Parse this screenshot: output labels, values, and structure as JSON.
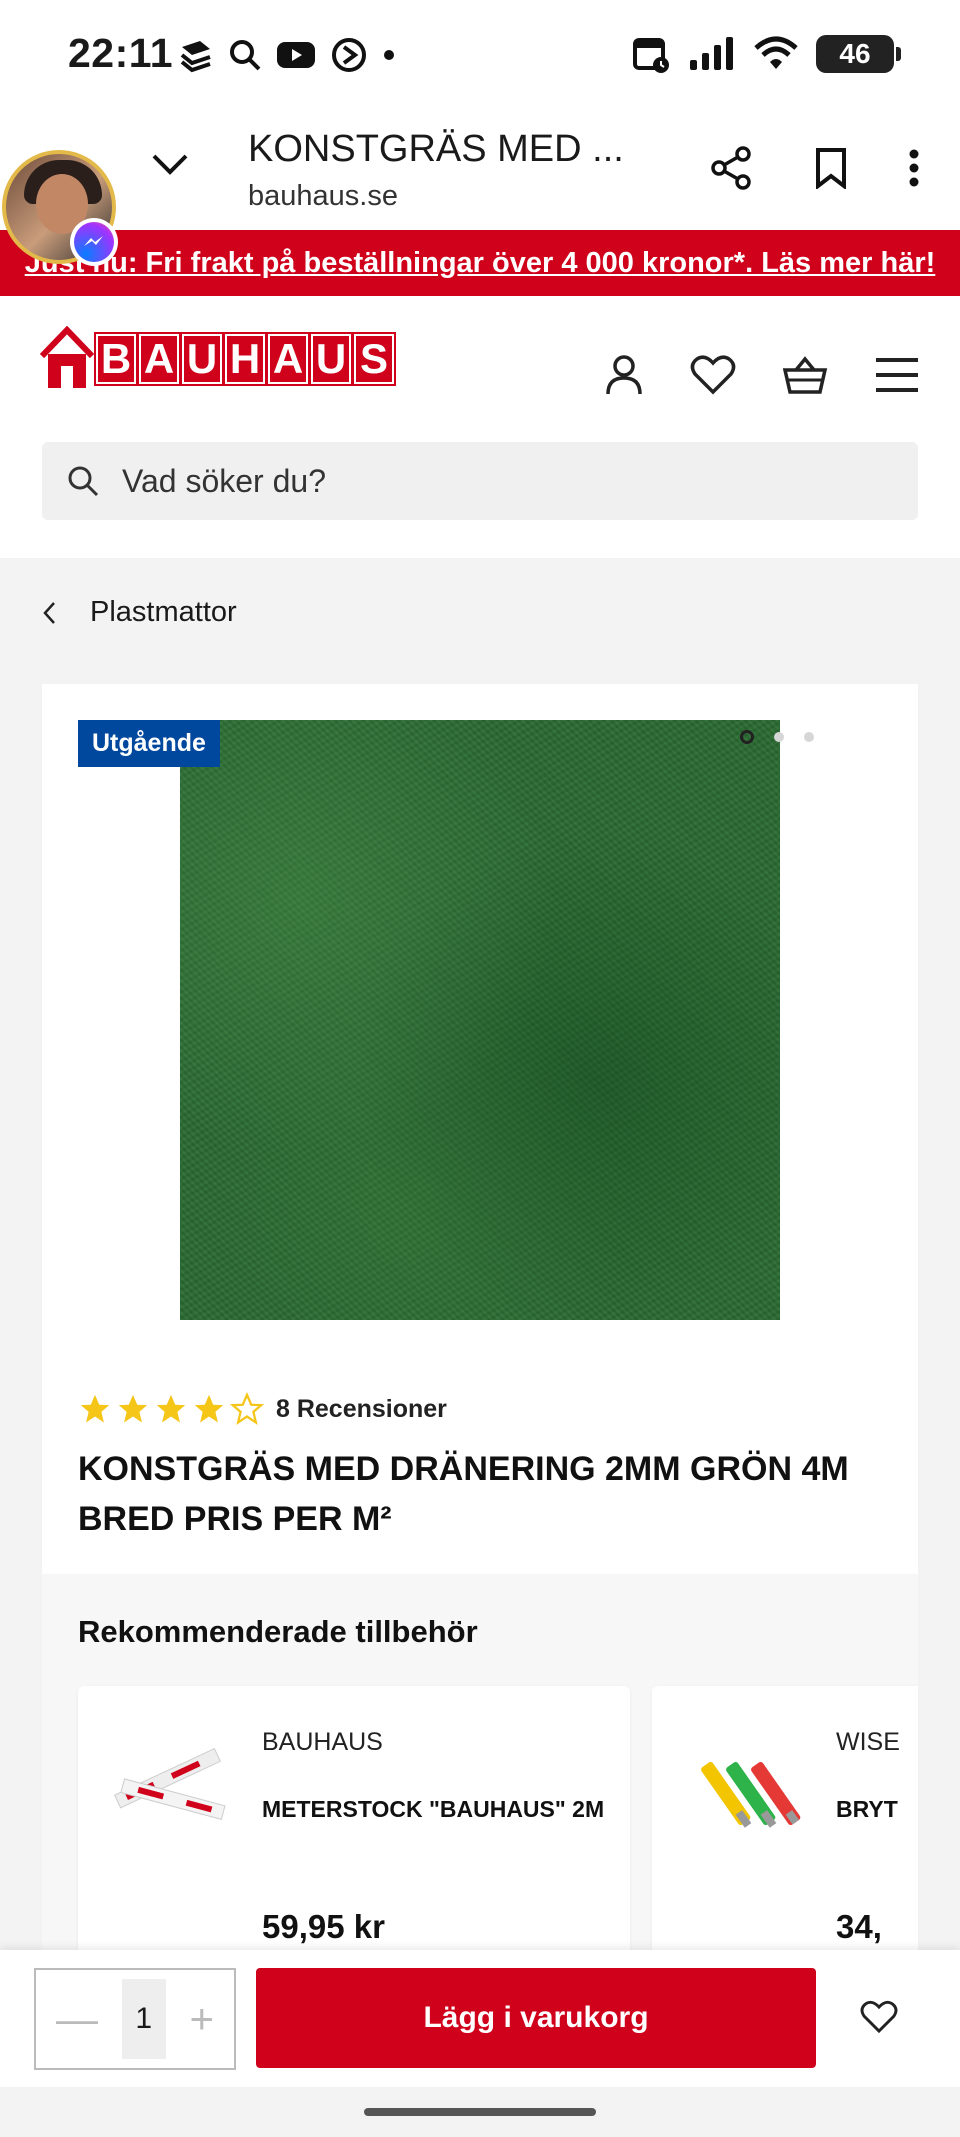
{
  "status_bar": {
    "time": "22:11",
    "battery": "46",
    "icons": [
      "notification-stack-icon",
      "search-icon",
      "youtube-icon",
      "clock-arrow-icon",
      "dot-icon",
      "calendar-icon",
      "signal-icon",
      "wifi-icon",
      "battery-icon"
    ]
  },
  "browser": {
    "page_title": "KONSTGRÄS MED ...",
    "url": "bauhaus.se"
  },
  "promo": {
    "text": "Just nu: Fri frakt på beställningar över 4 000 kronor*. Läs mer här!"
  },
  "site": {
    "logo_text": [
      "B",
      "A",
      "U",
      "H",
      "A",
      "U",
      "S"
    ],
    "search_placeholder": "Vad söker du?"
  },
  "breadcrumb": {
    "label": "Plastmattor"
  },
  "product": {
    "badge": "Utgående",
    "rating": 4,
    "rating_max": 5,
    "reviews": "8 Recensioner",
    "title": "KONSTGRÄS MED DRÄNERING 2MM GRÖN 4M BRED PRIS PER M²",
    "gallery_dots": 3,
    "gallery_active_index": 0
  },
  "recommended": {
    "title": "Rekommenderade tillbehör",
    "items": [
      {
        "brand": "BAUHAUS",
        "name": "METERSTOCK \"BAUHAUS\" 2M",
        "price": "59,95 kr"
      },
      {
        "brand": "WISE",
        "name": "BRYT",
        "price": "34,"
      }
    ]
  },
  "bottom_bar": {
    "quantity": "1",
    "minus": "—",
    "plus": "+",
    "add_to_cart": "Lägg i varukorg"
  },
  "colors": {
    "brand_red": "#d0021b",
    "badge_blue": "#00479e",
    "star_yellow": "#f5c518"
  }
}
